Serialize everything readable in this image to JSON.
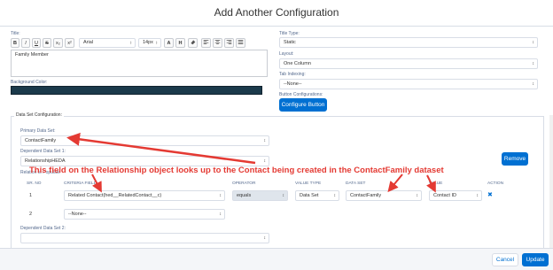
{
  "dialog": {
    "title": "Add Another Configuration"
  },
  "left": {
    "title_label": "Title:",
    "toolbar": {
      "bold": "B",
      "italic": "I",
      "underline": "U",
      "strike": "S",
      "subscript": "x₂",
      "superscript": "x²",
      "font": "Arial",
      "size": "14px",
      "font_color": "A",
      "highlight": "H"
    },
    "title_text": "Family Member",
    "bg_label": "Background Color:"
  },
  "right": {
    "title_type_label": "Title Type:",
    "title_type_value": "Static",
    "layout_label": "Layout:",
    "layout_value": "One Column",
    "tab_indexing_label": "Tab Indexing:",
    "tab_indexing_value": "--None--",
    "button_config_label": "Button Configurations:",
    "configure_button": "Configure Button"
  },
  "dataset": {
    "legend": "Data Set Configuration:",
    "primary_label": "Primary Data Set:",
    "primary_value": "ContactFamily",
    "dependent1_label": "Dependent Data Set 1:",
    "dependent1_value": "RelationshipHEDA",
    "relation_label": "Relation to Populate",
    "remove_button": "Remove",
    "columns": [
      "SR. NO",
      "CRITERIA FIELD",
      "OPERATOR",
      "VALUE TYPE",
      "DATA SET",
      "VALUE",
      "ACTION"
    ],
    "rows": [
      {
        "sr": "1",
        "field": "Related Contact(hed__RelatedContact__c)",
        "operator": "equals",
        "value_type": "Data Set",
        "data_set": "ContactFamily",
        "value": "Contact ID",
        "action": "✖"
      },
      {
        "sr": "2",
        "field": "--None--"
      }
    ],
    "dependent2_label": "Dependent Data Set 2:"
  },
  "annotation": "This field on the Relationship object looks up to the Contact being created in the ContactFamily dataset",
  "footer": {
    "cancel": "Cancel",
    "update": "Update"
  }
}
